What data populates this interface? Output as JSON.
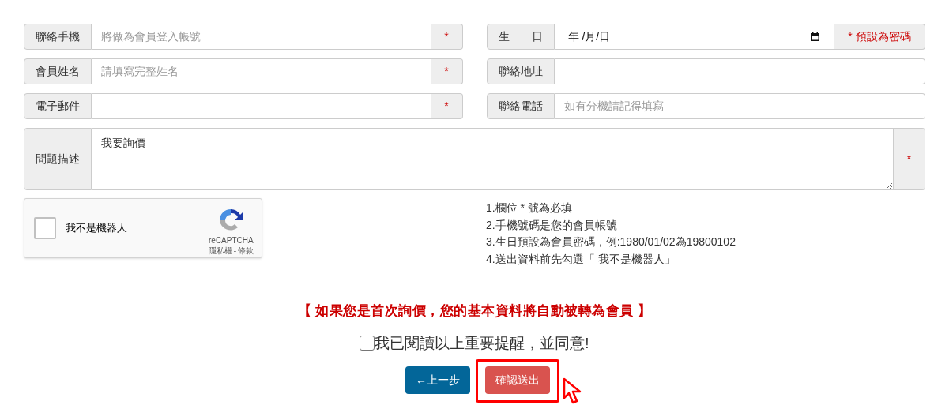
{
  "form": {
    "left_fields": [
      {
        "kind": "text",
        "label": "聯絡手機",
        "placeholder": "將做為會員登入帳號",
        "suffix": "*"
      },
      {
        "kind": "text",
        "label": "會員姓名",
        "placeholder": "請填寫完整姓名",
        "suffix": "*"
      },
      {
        "kind": "text",
        "label": "電子郵件",
        "suffix": "*"
      }
    ],
    "right_fields": [
      {
        "kind": "date",
        "label": "生　　日",
        "value": "年 /月/日",
        "suffix": "* 預設為密碼"
      },
      {
        "kind": "text",
        "label": "聯絡地址"
      },
      {
        "kind": "text",
        "label": "聯絡電話",
        "placeholder": "如有分機請記得填寫"
      }
    ],
    "description": {
      "label": "問題描述",
      "value": "我要詢價",
      "suffix": "*"
    }
  },
  "captcha": {
    "checked": false,
    "label": "我不是機器人",
    "brand": "reCAPTCHA",
    "links": [
      "隱私權",
      "條款"
    ],
    "separator": "-"
  },
  "notes": [
    "1.欄位 * 號為必填",
    "2.手機號碼是您的會員帳號",
    "3.生日預設為會員密碼，例:1980/01/02為19800102",
    "4.送出資料前先勾選「 我不是機器人」"
  ],
  "notice": "【 如果您是首次詢價，您的基本資料將自動被轉為會員 】",
  "agree": {
    "checked": false,
    "label": "我已閱讀以上重要提醒，並同意!"
  },
  "buttons": [
    {
      "kind": "back",
      "label": "←上一步"
    },
    {
      "kind": "submit",
      "label": "確認送出",
      "highlighted": true
    }
  ]
}
